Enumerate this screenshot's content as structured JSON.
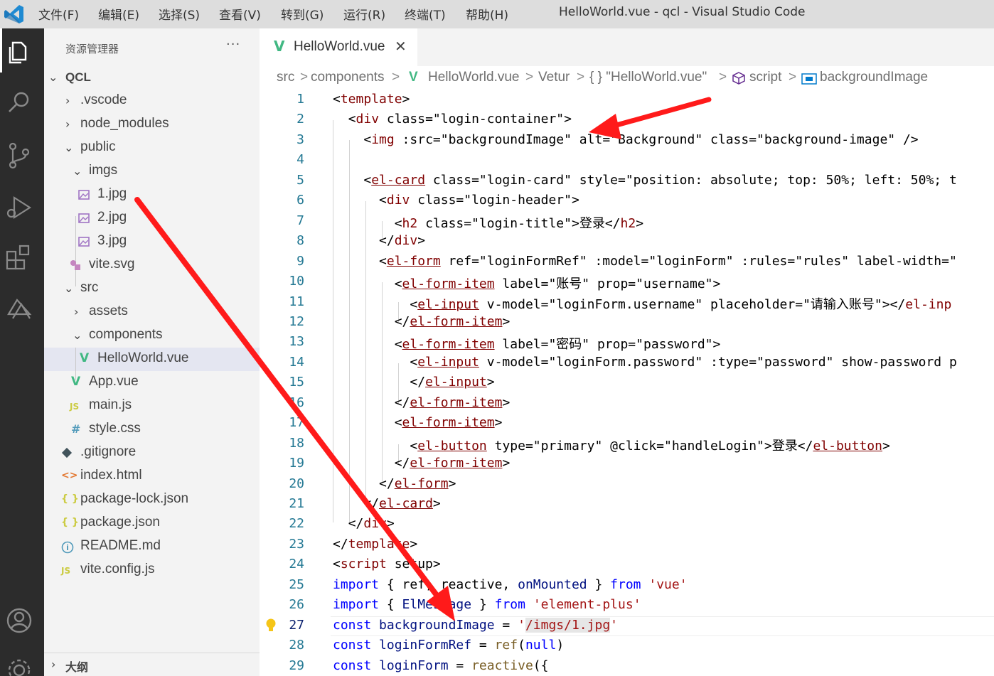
{
  "titlebar": {
    "menu": [
      "文件(F)",
      "编辑(E)",
      "选择(S)",
      "查看(V)",
      "转到(G)",
      "运行(R)",
      "终端(T)",
      "帮助(H)"
    ],
    "window_title": "HelloWorld.vue - qcl - Visual Studio Code"
  },
  "activity_bar": [
    "explorer-icon",
    "search-icon",
    "source-control-icon",
    "run-debug-icon",
    "extensions-icon",
    "remote-icon",
    "accounts-icon",
    "settings-gear-icon"
  ],
  "sidebar": {
    "title": "资源管理器",
    "more": "···",
    "root": "QCL",
    "outline": "大纲",
    "tree": [
      {
        "label": ".vscode",
        "type": "folder",
        "open": false
      },
      {
        "label": "node_modules",
        "type": "folder",
        "open": false
      },
      {
        "label": "public",
        "type": "folder",
        "open": true
      },
      {
        "label": "imgs",
        "type": "folder",
        "open": true
      },
      {
        "label": "1.jpg",
        "type": "image"
      },
      {
        "label": "2.jpg",
        "type": "image"
      },
      {
        "label": "3.jpg",
        "type": "image"
      },
      {
        "label": "vite.svg",
        "type": "svg"
      },
      {
        "label": "src",
        "type": "folder",
        "open": true
      },
      {
        "label": "assets",
        "type": "folder",
        "open": false
      },
      {
        "label": "components",
        "type": "folder",
        "open": true
      },
      {
        "label": "HelloWorld.vue",
        "type": "vue",
        "selected": true
      },
      {
        "label": "App.vue",
        "type": "vue"
      },
      {
        "label": "main.js",
        "type": "js"
      },
      {
        "label": "style.css",
        "type": "css"
      },
      {
        "label": ".gitignore",
        "type": "git"
      },
      {
        "label": "index.html",
        "type": "html"
      },
      {
        "label": "package-lock.json",
        "type": "json"
      },
      {
        "label": "package.json",
        "type": "json"
      },
      {
        "label": "README.md",
        "type": "info"
      },
      {
        "label": "vite.config.js",
        "type": "js"
      }
    ],
    "icons": {
      "js": "JS",
      "css": "#",
      "json": "{ }",
      "html": "<>",
      "vue": "V",
      "info": "i"
    }
  },
  "editor": {
    "tab": {
      "label": "HelloWorld.vue",
      "close": "✕"
    },
    "breadcrumb": [
      "src",
      "components",
      "HelloWorld.vue",
      "Vetur",
      "{ } \"HelloWorld.vue\"",
      "script",
      "backgroundImage"
    ],
    "breadcrumb_sep": ">",
    "line_numbers": [
      "1",
      "2",
      "3",
      "4",
      "5",
      "6",
      "7",
      "8",
      "9",
      "10",
      "11",
      "12",
      "13",
      "14",
      "15",
      "16",
      "17",
      "18",
      "19",
      "20",
      "21",
      "22",
      "23",
      "24",
      "25",
      "26",
      "27",
      "28",
      "29"
    ],
    "lines": [
      "<template>",
      "  <div class=\"login-container\">",
      "    <img :src=\"backgroundImage\" alt=\"Background\" class=\"background-image\" />",
      "",
      "    <el-card class=\"login-card\" style=\"position: absolute; top: 50%; left: 50%; t",
      "      <div class=\"login-header\">",
      "        <h2 class=\"login-title\">登录</h2>",
      "      </div>",
      "      <el-form ref=\"loginFormRef\" :model=\"loginForm\" :rules=\"rules\" label-width=\"",
      "        <el-form-item label=\"账号\" prop=\"username\">",
      "          <el-input v-model=\"loginForm.username\" placeholder=\"请输入账号\"></el-inp",
      "        </el-form-item>",
      "        <el-form-item label=\"密码\" prop=\"password\">",
      "          <el-input v-model=\"loginForm.password\" :type=\"password\" show-password p",
      "          </el-input>",
      "        </el-form-item>",
      "        <el-form-item>",
      "          <el-button type=\"primary\" @click=\"handleLogin\">登录</el-button>",
      "        </el-form-item>",
      "      </el-form>",
      "    </el-card>",
      "  </div>",
      "</template>",
      "<script setup>",
      "import { ref, reactive, onMounted } from 'vue'",
      "import { ElMessage } from 'element-plus'",
      "const backgroundImage = '/imgs/1.jpg'",
      "const loginFormRef = ref(null)",
      "const loginForm = reactive({"
    ]
  },
  "colors": {
    "annotation_arrow": "#ff1a1a",
    "activity_bar": "#2c2c2c",
    "sidebar": "#f3f3f3",
    "titlebar": "#dddddd"
  }
}
